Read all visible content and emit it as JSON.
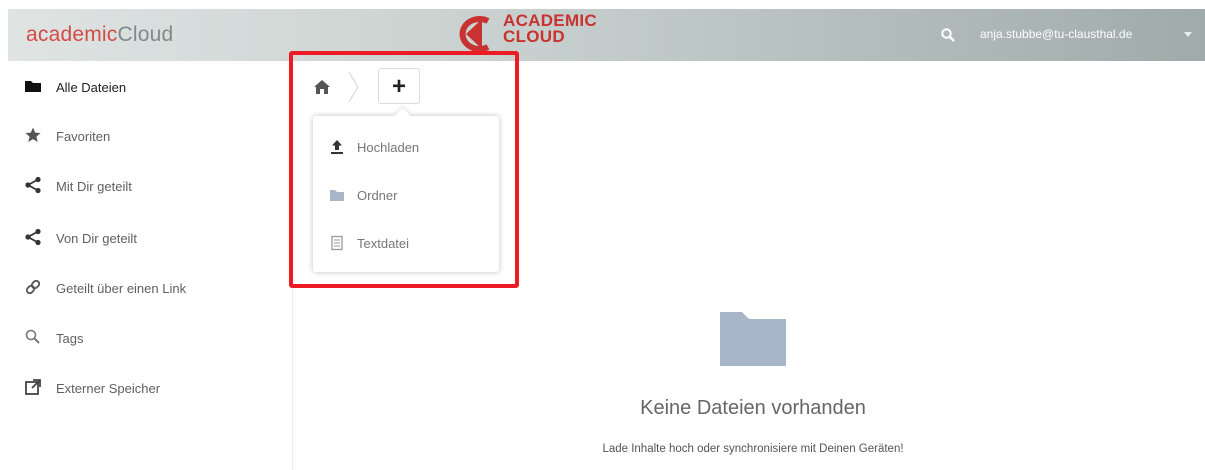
{
  "header": {
    "brand_part1": "academic",
    "brand_part2": "Cloud",
    "logo_line1": "ACADEMIC",
    "logo_line2": "CLOUD",
    "user_email": "anja.stubbe@tu-clausthal.de",
    "icons": {
      "search": "search-icon",
      "user_menu": "caret-down-icon"
    }
  },
  "sidebar": {
    "items": [
      {
        "label": "Alle Dateien",
        "icon": "folder-icon",
        "active": true
      },
      {
        "label": "Favoriten",
        "icon": "star-icon"
      },
      {
        "label": "Mit Dir geteilt",
        "icon": "share-icon"
      },
      {
        "label": "Von Dir geteilt",
        "icon": "share-icon"
      },
      {
        "label": "Geteilt über einen Link",
        "icon": "link-icon"
      },
      {
        "label": "Tags",
        "icon": "search-icon"
      },
      {
        "label": "Externer Speicher",
        "icon": "external-link-icon"
      }
    ]
  },
  "controls": {
    "add_label": "+",
    "icons": {
      "home": "home-icon",
      "separator": "breadcrumb-chevron-icon"
    }
  },
  "new_menu": {
    "items": [
      {
        "label": "Hochladen",
        "icon": "upload-icon"
      },
      {
        "label": "Ordner",
        "icon": "folder-icon"
      },
      {
        "label": "Textdatei",
        "icon": "text-file-icon"
      }
    ]
  },
  "empty_state": {
    "title": "Keine Dateien vorhanden",
    "subtitle": "Lade Inhalte hoch oder synchronisiere mit Deinen Geräten!",
    "icon": "folder-icon"
  },
  "colors": {
    "brand_red": "#d34a46",
    "highlight_red": "#ec1b24",
    "folder_blue": "#a9b5c9",
    "text_gray": "#606060"
  }
}
